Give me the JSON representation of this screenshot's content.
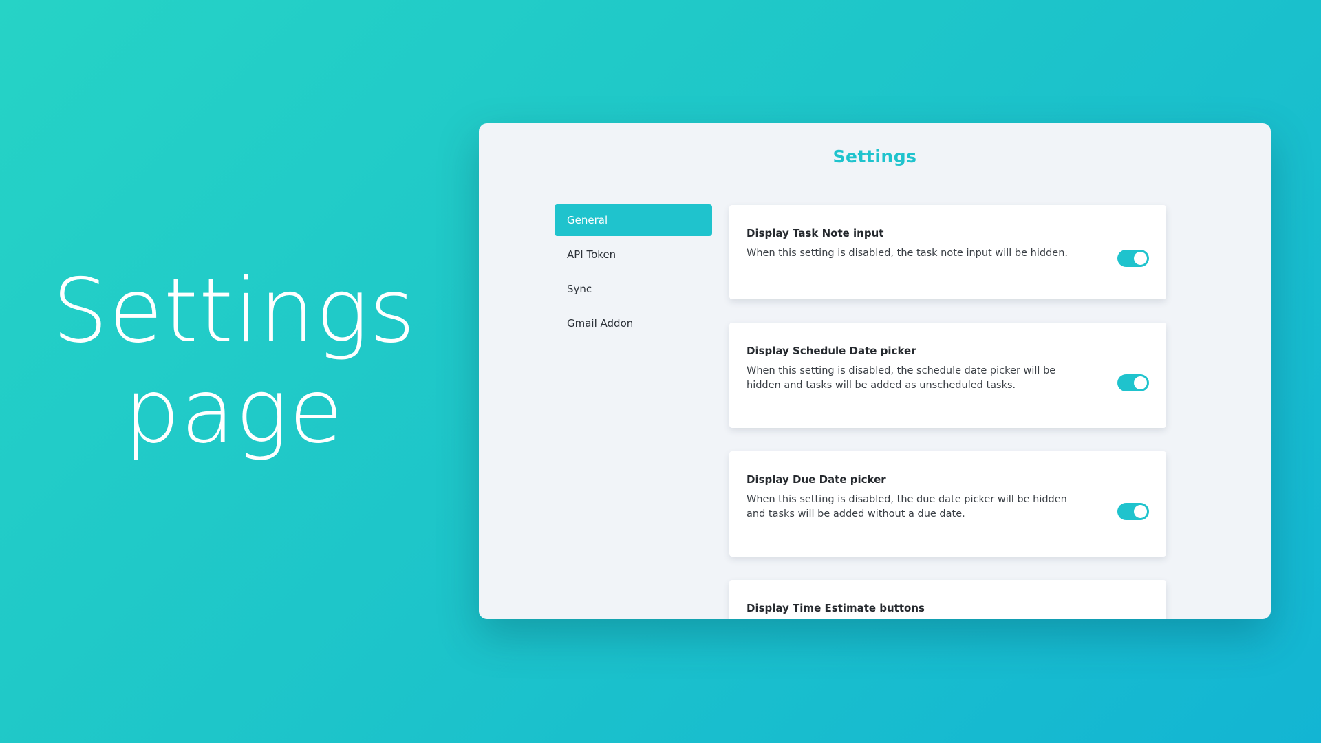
{
  "hero": {
    "line1": "Settings",
    "line2": "page"
  },
  "window": {
    "title": "Settings"
  },
  "sidebar": {
    "items": [
      {
        "label": "General",
        "active": true
      },
      {
        "label": "API Token",
        "active": false
      },
      {
        "label": "Sync",
        "active": false
      },
      {
        "label": "Gmail Addon",
        "active": false
      }
    ]
  },
  "settings": [
    {
      "title": "Display Task Note input",
      "description": "When this setting is disabled, the task note input will be hidden.",
      "enabled": true
    },
    {
      "title": "Display Schedule Date picker",
      "description": "When this setting is disabled, the schedule date picker will be hidden and tasks will be added as unscheduled tasks.",
      "enabled": true
    },
    {
      "title": "Display Due Date picker",
      "description": "When this setting is disabled, the due date picker will be hidden and tasks will be added without a due date.",
      "enabled": true
    },
    {
      "title": "Display Time Estimate buttons",
      "description": "",
      "enabled": true
    }
  ],
  "colors": {
    "accent": "#1fc3cd",
    "background_start": "#26d3c6",
    "background_end": "#13b5d3",
    "panel": "#f1f4f8"
  }
}
